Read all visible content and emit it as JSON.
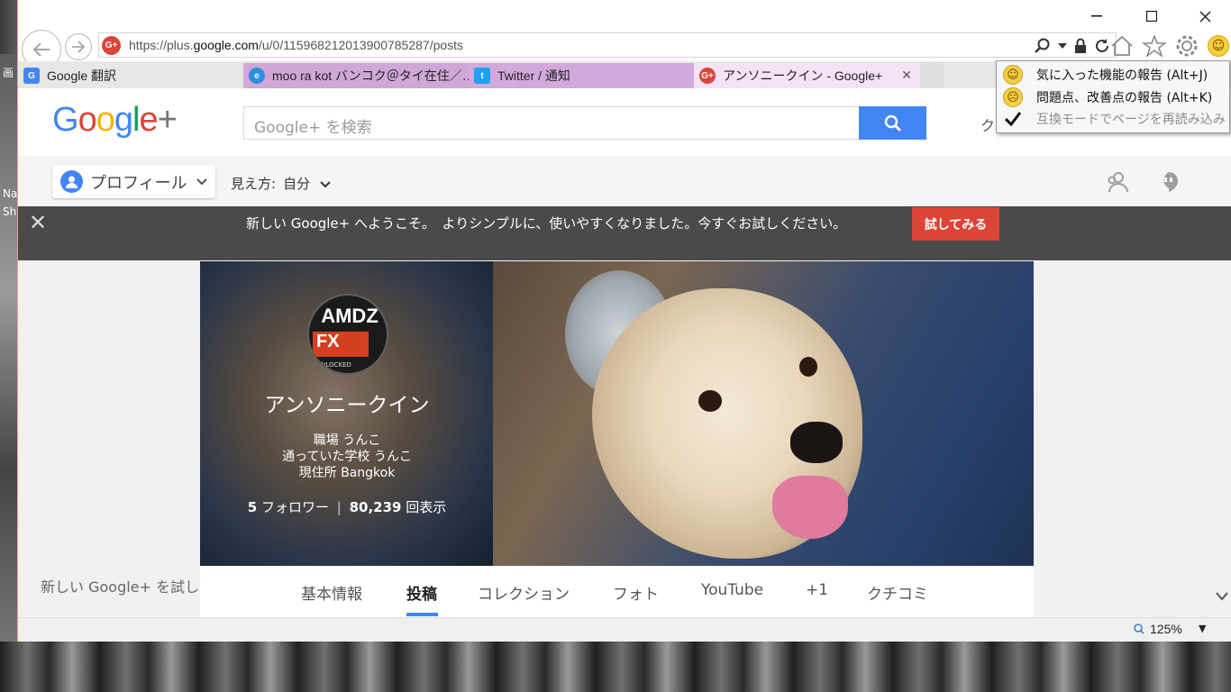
{
  "desktop": {
    "left_text_1": "画",
    "left_text_2": "Na",
    "left_text_3": "Sh"
  },
  "window": {
    "minimize": "—",
    "maximize": "☐",
    "close": "✕"
  },
  "address_bar": {
    "favicon": "G+",
    "url_prefix": "https://plus.",
    "url_host": "google.com",
    "url_path": "/u/0/115968212013900785287/posts"
  },
  "tabs": [
    {
      "label": "Google 翻訳",
      "icon": "google-translate-icon"
    },
    {
      "label": "moo ra kot バンコク＠タイ在住／…",
      "icon": "ie-icon"
    },
    {
      "label": "Twitter / 通知",
      "icon": "twitter-icon"
    },
    {
      "label": "アンソニークイン - Google+",
      "icon": "gplus-icon"
    }
  ],
  "gplus": {
    "search_placeholder": "Google+ を検索",
    "header_right": "ク",
    "profile_label": "プロフィール",
    "view_as_label": "見え方:",
    "view_as_value": "自分",
    "banner_message": "新しい Google+ へようこそ。　よりシンプルに、使いやすくなりました。今すぐお試しください。",
    "banner_button": "試してみる",
    "profile": {
      "name": "アンソニークイン",
      "work": "職場 うんこ",
      "school": "通っていた学校 うんこ",
      "location": "現住所 Bangkok",
      "followers_count": "5",
      "followers_label": "フォロワー",
      "views_count": "80,239",
      "views_label": "回表示"
    },
    "avatar": {
      "brand": "AMDZ",
      "fx": "FX",
      "sub": "UNLOCKED"
    },
    "profile_tabs": [
      "基本情報",
      "投稿",
      "コレクション",
      "フォト",
      "YouTube",
      "+1",
      "クチコミ"
    ],
    "active_tab": "投稿",
    "try_new": "新しい Google+ を試してみる"
  },
  "statusbar": {
    "zoom": "125%"
  },
  "feedback_menu": {
    "items": [
      {
        "label": "気に入った機能の報告 (Alt+J)",
        "icon": "smile-face-icon"
      },
      {
        "label": "問題点、改善点の報告 (Alt+K)",
        "icon": "frown-face-icon"
      },
      {
        "label": "互換モードでページを再読み込み",
        "icon": "checkmark-icon"
      }
    ]
  },
  "colors": {
    "google_blue": "#4285f4",
    "google_red": "#db4437",
    "banner_bg": "#4a4a4a"
  }
}
